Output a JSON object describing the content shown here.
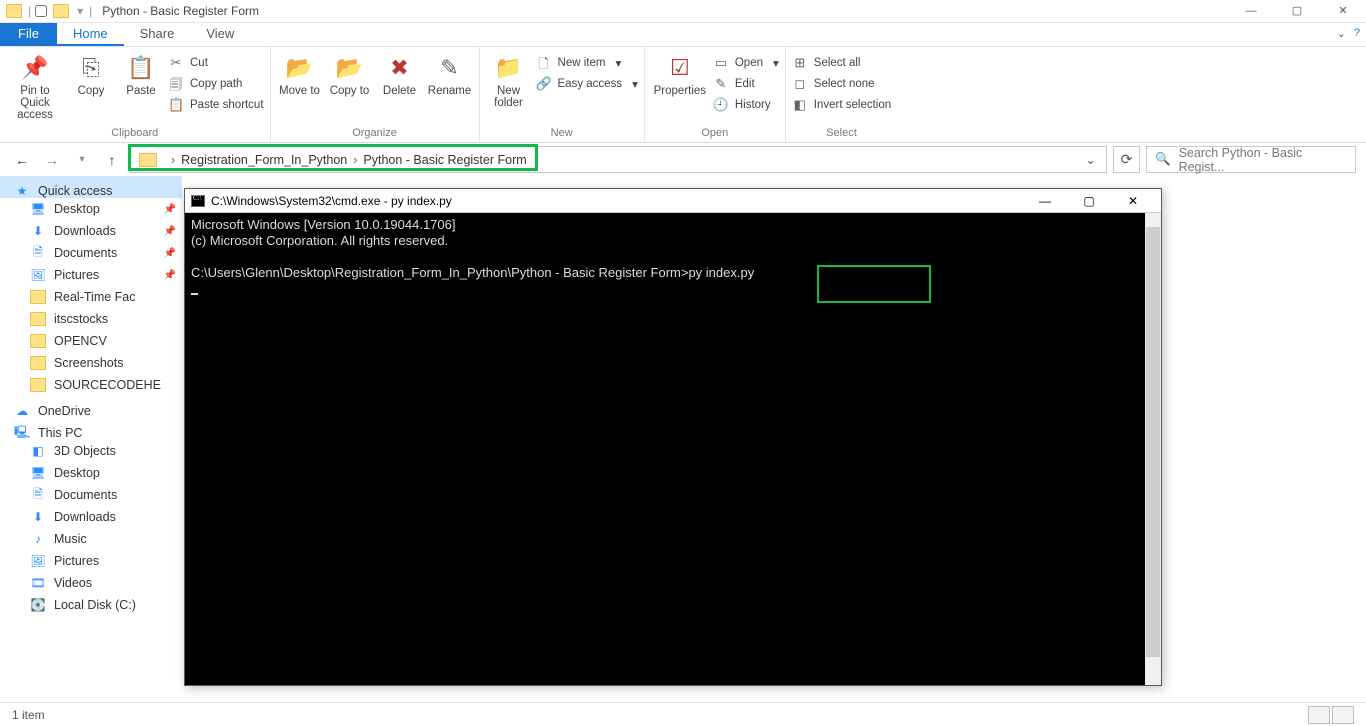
{
  "window": {
    "title": "Python - Basic Register Form",
    "min": "—",
    "max": "▢",
    "close": "✕"
  },
  "tabs": {
    "file": "File",
    "home": "Home",
    "share": "Share",
    "view": "View"
  },
  "ribbon": {
    "clipboard": {
      "pin": "Pin to Quick access",
      "copy": "Copy",
      "paste": "Paste",
      "cut": "Cut",
      "copy_path": "Copy path",
      "paste_shortcut": "Paste shortcut",
      "label": "Clipboard"
    },
    "organize": {
      "move": "Move to",
      "copy_to": "Copy to",
      "delete": "Delete",
      "rename": "Rename",
      "label": "Organize"
    },
    "new": {
      "new_folder": "New folder",
      "new_item": "New item",
      "easy_access": "Easy access",
      "label": "New"
    },
    "open": {
      "properties": "Properties",
      "open": "Open",
      "edit": "Edit",
      "history": "History",
      "label": "Open"
    },
    "select": {
      "select_all": "Select all",
      "select_none": "Select none",
      "invert": "Invert selection",
      "label": "Select"
    }
  },
  "address": {
    "crumb1": "Registration_Form_In_Python",
    "crumb2": "Python - Basic Register Form",
    "search_placeholder": "Search Python - Basic Regist..."
  },
  "tree": {
    "quick": "Quick access",
    "desktop": "Desktop",
    "downloads": "Downloads",
    "documents": "Documents",
    "pictures": "Pictures",
    "realtime": "Real-Time Fac",
    "itsc": "itscstocks",
    "opencv": "OPENCV",
    "screenshots": "Screenshots",
    "sourcecode": "SOURCECODEHE",
    "onedrive": "OneDrive",
    "thispc": "This PC",
    "pc_3d": "3D Objects",
    "pc_desktop": "Desktop",
    "pc_docs": "Documents",
    "pc_dl": "Downloads",
    "pc_music": "Music",
    "pc_pics": "Pictures",
    "pc_videos": "Videos",
    "pc_localdisk": "Local Disk (C:)"
  },
  "statusbar": {
    "count": "1 item"
  },
  "cmd": {
    "title": "C:\\Windows\\System32\\cmd.exe - py  index.py",
    "line1": "Microsoft Windows [Version 10.0.19044.1706]",
    "line2": "(c) Microsoft Corporation. All rights reserved.",
    "prompt": "C:\\Users\\Glenn\\Desktop\\Registration_Form_In_Python\\Python - Basic Register Form>",
    "command": "py index.py"
  }
}
